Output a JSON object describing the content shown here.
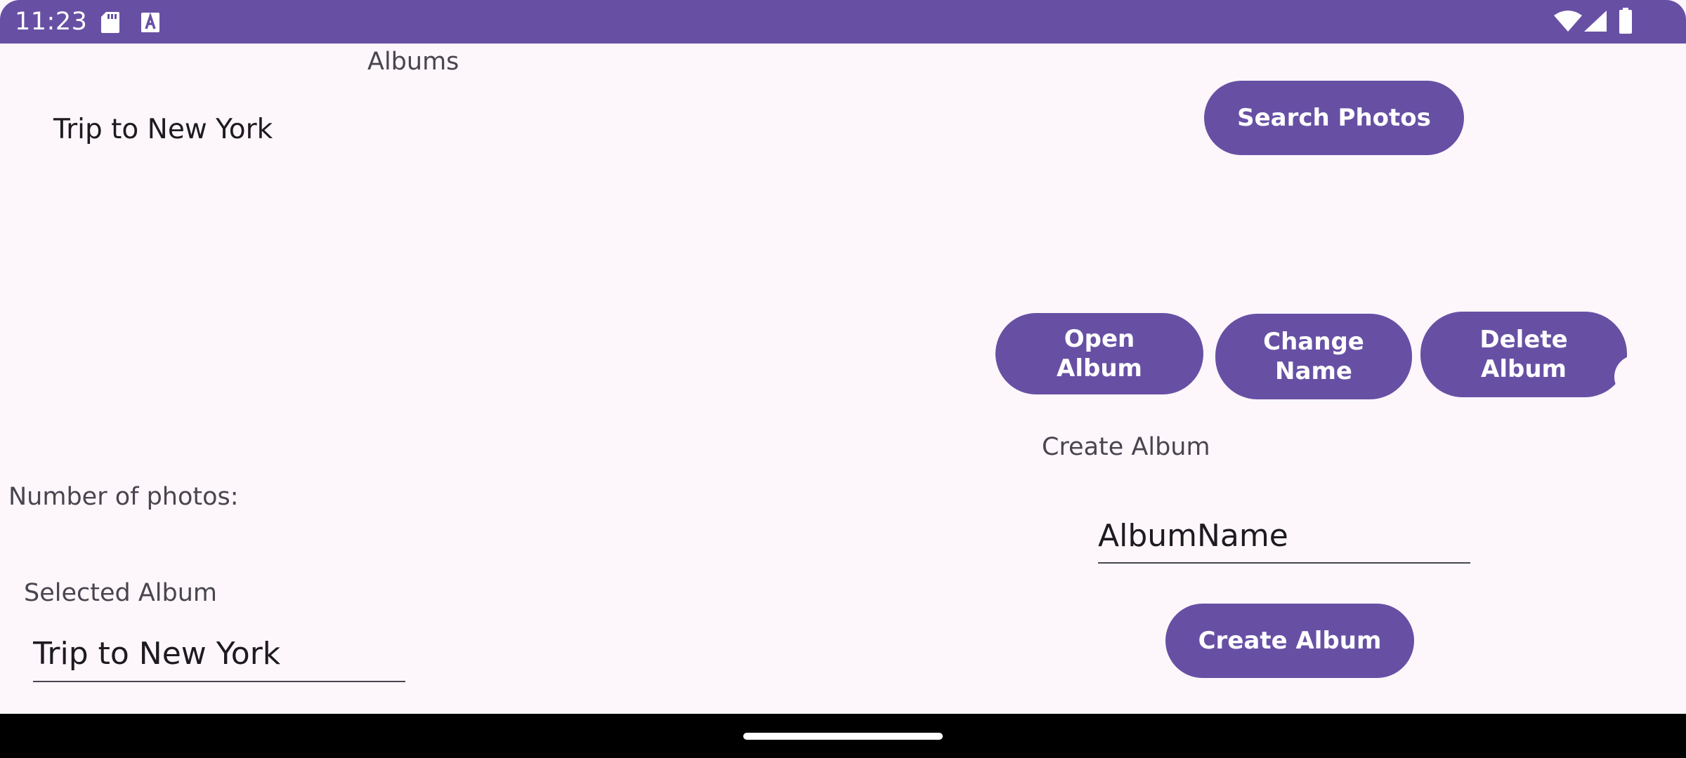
{
  "status_bar": {
    "time": "11:23",
    "icons": [
      "sd-card-icon",
      "text-a-icon",
      "wifi-icon",
      "signal-icon",
      "battery-icon"
    ],
    "color": "#6750a4"
  },
  "albums": {
    "header": "Albums",
    "items": [
      "Trip to New York"
    ]
  },
  "actions": {
    "search_label": "Search Photos",
    "open_line1": "Open",
    "open_line2": "Album",
    "change_line1": "Change",
    "change_line2": "Name",
    "delete_line1": "Delete",
    "delete_line2": "Album"
  },
  "info": {
    "number_of_photos_label": "Number of photos:",
    "selected_label": "Selected Album",
    "selected_value": "Trip to New York"
  },
  "create": {
    "label": "Create Album",
    "input_value": "AlbumName",
    "button_label": "Create Album"
  },
  "theme": {
    "primary": "#6750a4",
    "background": "#fdf7fc"
  }
}
